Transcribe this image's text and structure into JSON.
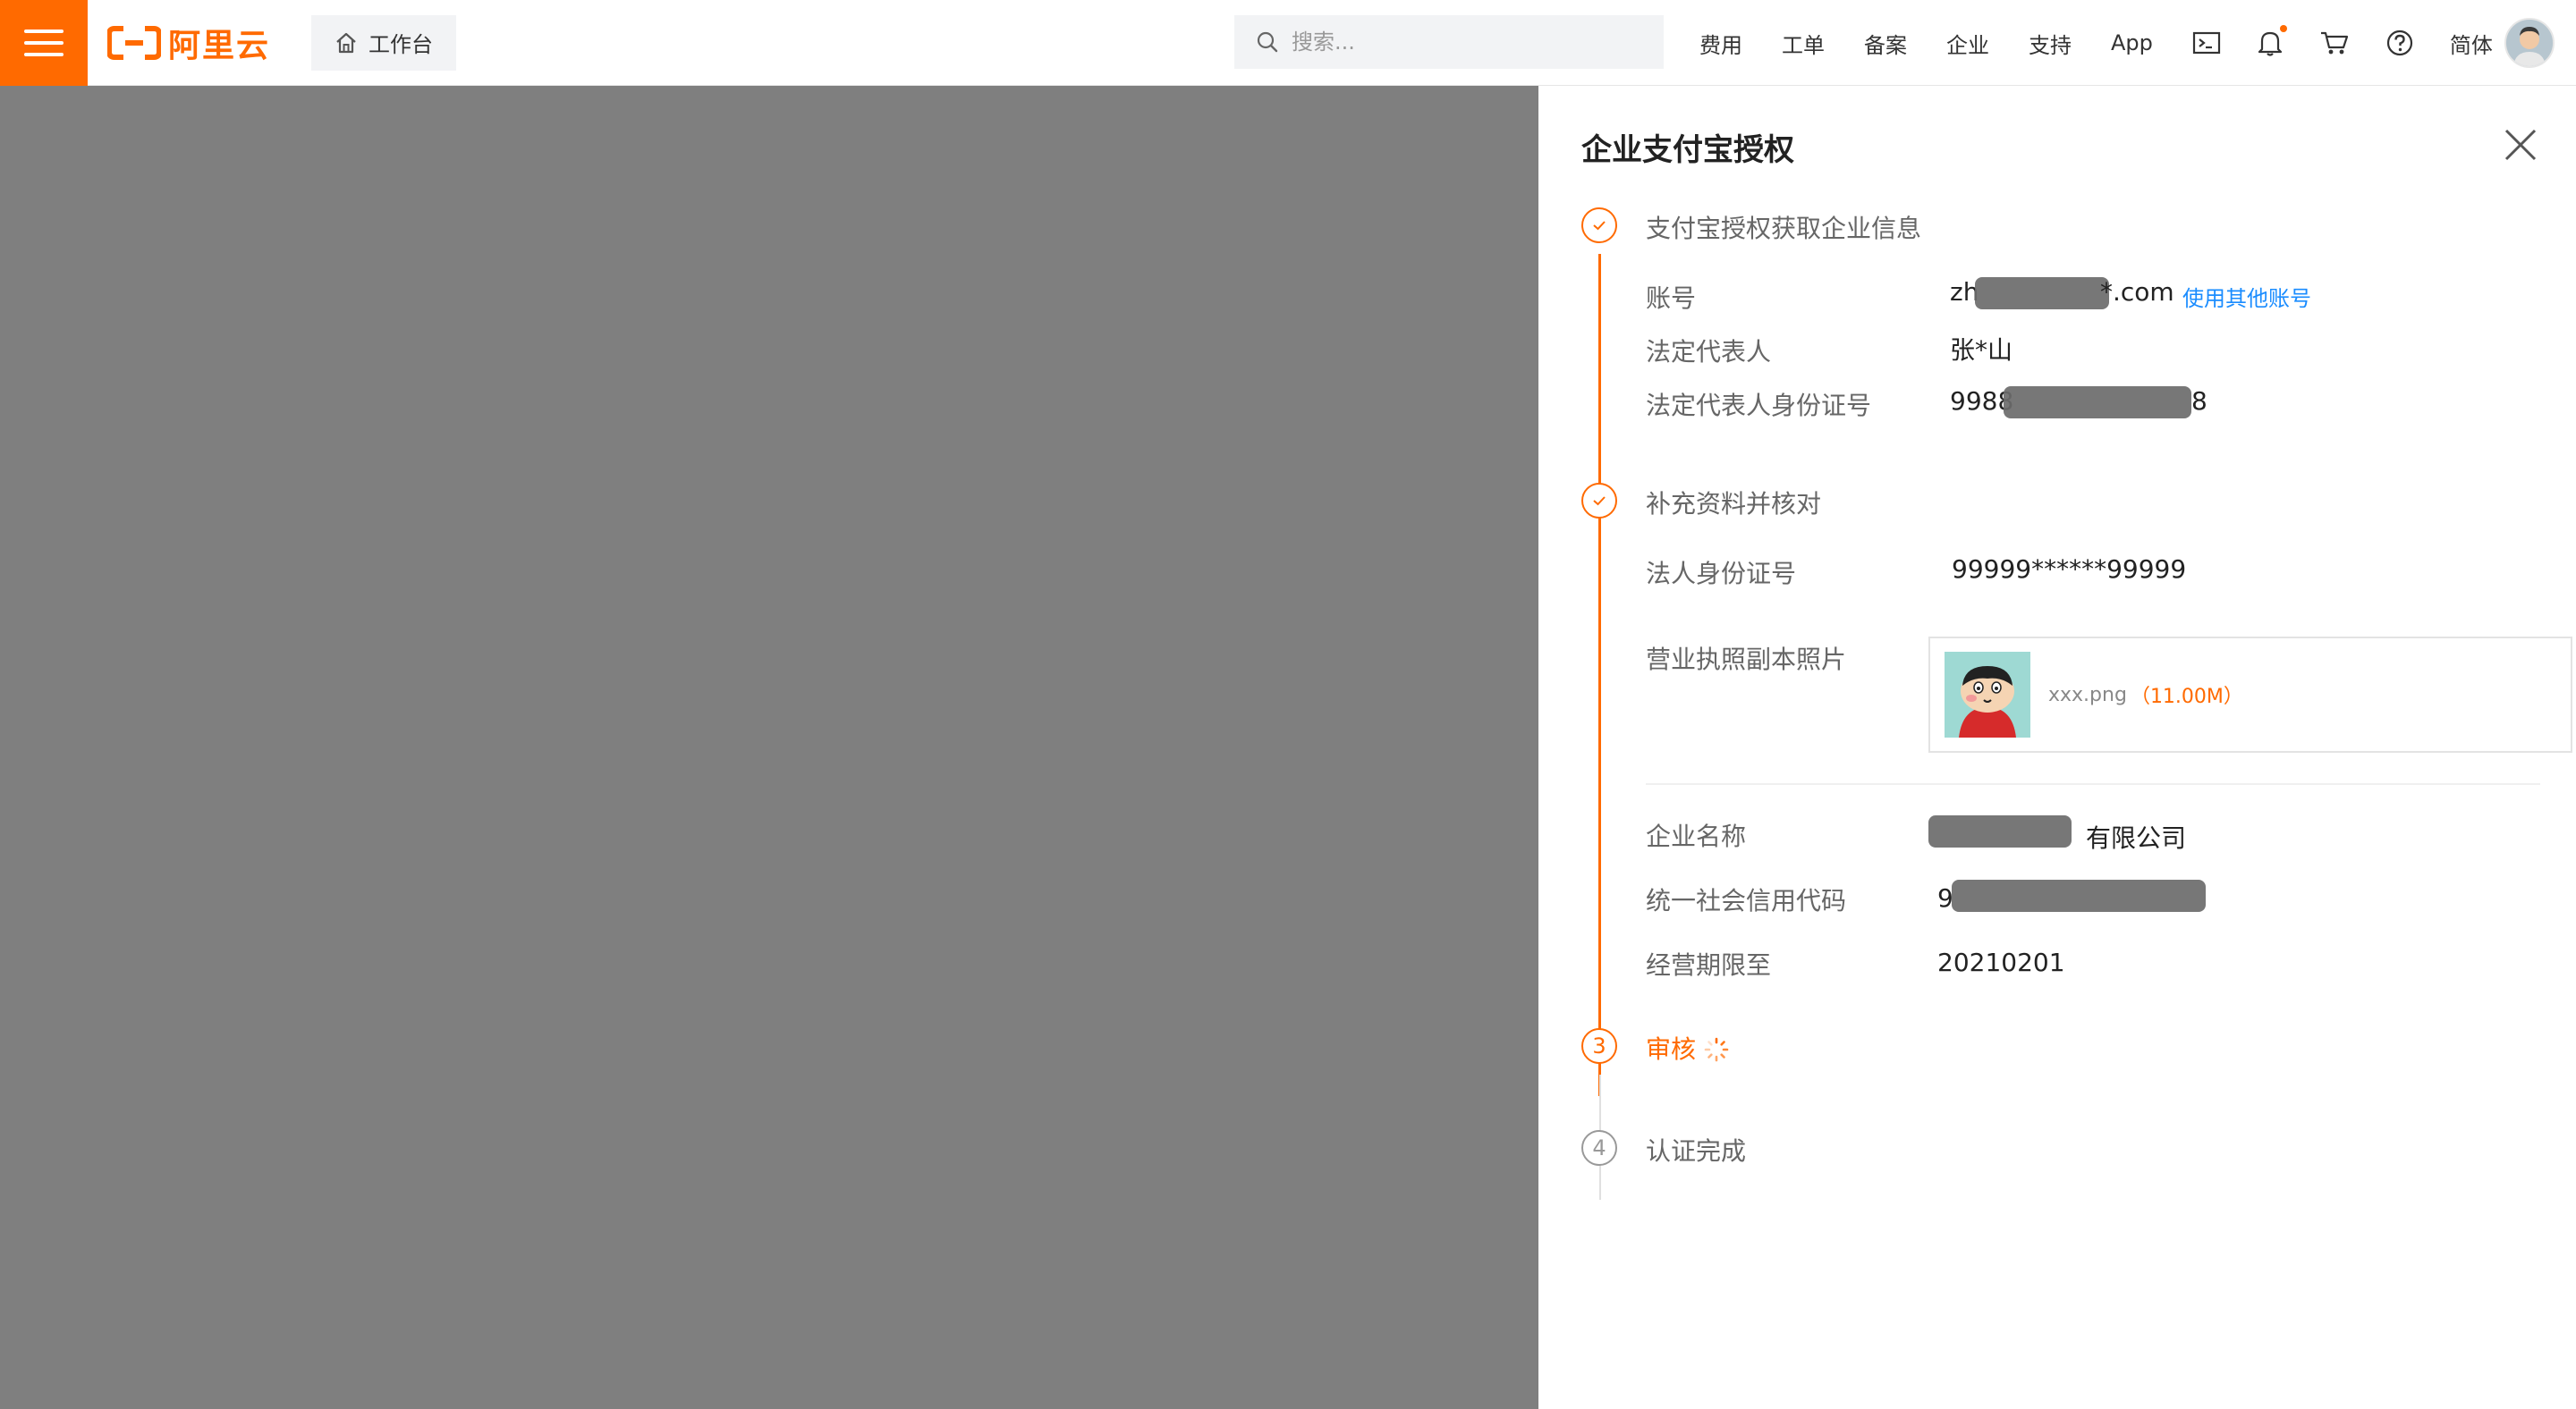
{
  "header": {
    "logo_text": "阿里云",
    "workbench_label": "工作台",
    "search_placeholder": "搜索...",
    "nav_items": [
      "费用",
      "工单",
      "备案",
      "企业",
      "支持",
      "App"
    ],
    "lang_label": "简体",
    "accent_color": "#ff6a00"
  },
  "drawer": {
    "title": "企业支付宝授权",
    "steps": [
      {
        "index": "1",
        "title": "支付宝授权获取企业信息",
        "state": "done"
      },
      {
        "index": "2",
        "title": "补充资料并核对",
        "state": "done"
      },
      {
        "index": "3",
        "title": "审核",
        "state": "active"
      },
      {
        "index": "4",
        "title": "认证完成",
        "state": "pending"
      }
    ],
    "step1": {
      "account_label": "账号",
      "account_prefix": "zh",
      "account_suffix": "*.com",
      "switch_account_link": "使用其他账号",
      "legal_rep_label": "法定代表人",
      "legal_rep_value": "张*山",
      "legal_id_label": "法定代表人身份证号",
      "legal_id_prefix": "9988",
      "legal_id_suffix": "8"
    },
    "step2": {
      "id_label": "法人身份证号",
      "id_value": "99999******99999",
      "license_label": "营业执照副本照片",
      "file_name": "xxx.png",
      "file_size": "（11.00M）",
      "company_name_label": "企业名称",
      "company_name_suffix": "有限公司",
      "credit_code_label": "统一社会信用代码",
      "credit_code_prefix": "9",
      "term_label": "经营期限至",
      "term_value": "20210201"
    }
  }
}
